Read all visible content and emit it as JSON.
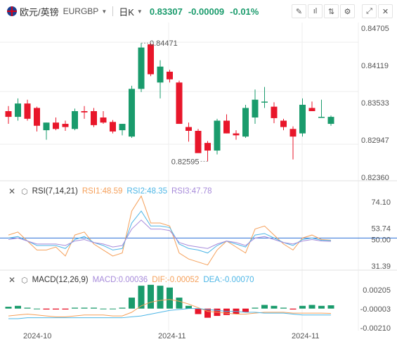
{
  "header": {
    "name": "欧元/英镑",
    "code": "EURGBP",
    "timeframe": "日K",
    "price": "0.83307",
    "change": "-0.00009",
    "change_pct": "-0.01%"
  },
  "toolbar": {
    "icons": [
      "draw-icon",
      "indicator-icon",
      "compare-icon",
      "settings-icon",
      "fullscreen-icon",
      "close-icon"
    ]
  },
  "colors": {
    "up": "#1a9b6c",
    "down": "#e8162a",
    "rsi1": "#f5a05a",
    "rsi2": "#4db6e6",
    "rsi3": "#a78bda",
    "macd": "#1a9b6c",
    "dif": "#f5a05a",
    "dea": "#4db6e6",
    "refline": "#2a6fd6"
  },
  "price_axis": [
    "0.84705",
    "0.84119",
    "0.83533",
    "0.82947",
    "0.82360"
  ],
  "high_label": "0.84471",
  "low_label": "0.82595",
  "rsi": {
    "title": "RSI(7,14,21)",
    "rsi1": "RSI1:48.59",
    "rsi2": "RSI2:48.35",
    "rsi3": "RSI3:47.78",
    "axis": [
      "74.10",
      "53.74",
      "50.00",
      "31.39"
    ]
  },
  "macd": {
    "title": "MACD(12,26,9)",
    "macd": "MACD:0.00036",
    "dif": "DIF:-0.00052",
    "dea": "DEA:-0.00070",
    "axis": [
      "0.00205",
      "-0.00003",
      "-0.00210"
    ]
  },
  "x_labels": [
    "2024-10",
    "2024-11",
    "2024-11"
  ],
  "chart_data": {
    "type": "candlestick",
    "ohlc": [
      [
        0.834,
        0.8348,
        0.832,
        0.8331
      ],
      [
        0.8331,
        0.836,
        0.8325,
        0.8352
      ],
      [
        0.8352,
        0.8358,
        0.8325,
        0.8328
      ],
      [
        0.8345,
        0.8347,
        0.8308,
        0.8317
      ],
      [
        0.831,
        0.8322,
        0.8295,
        0.8322
      ],
      [
        0.8322,
        0.833,
        0.831,
        0.8312
      ],
      [
        0.832,
        0.8325,
        0.8309,
        0.8315
      ],
      [
        0.8312,
        0.8344,
        0.831,
        0.834
      ],
      [
        0.834,
        0.8348,
        0.8328,
        0.8338
      ],
      [
        0.834,
        0.8345,
        0.8315,
        0.8318
      ],
      [
        0.833,
        0.834,
        0.832,
        0.8322
      ],
      [
        0.8323,
        0.8326,
        0.8305,
        0.8308
      ],
      [
        0.831,
        0.832,
        0.8302,
        0.832
      ],
      [
        0.83,
        0.838,
        0.8298,
        0.8375
      ],
      [
        0.8375,
        0.8447,
        0.837,
        0.844
      ],
      [
        0.8445,
        0.8447,
        0.8395,
        0.8398
      ],
      [
        0.8385,
        0.842,
        0.836,
        0.841
      ],
      [
        0.8402,
        0.8405,
        0.8385,
        0.839
      ],
      [
        0.8385,
        0.8388,
        0.834,
        0.832
      ],
      [
        0.8315,
        0.8322,
        0.8292,
        0.8309
      ],
      [
        0.8309,
        0.8312,
        0.8275,
        0.8274
      ],
      [
        0.829,
        0.8293,
        0.8261,
        0.8278
      ],
      [
        0.8278,
        0.8328,
        0.8272,
        0.8325
      ],
      [
        0.8325,
        0.8335,
        0.8305,
        0.8305
      ],
      [
        0.8305,
        0.831,
        0.8295,
        0.8302
      ],
      [
        0.83,
        0.835,
        0.8298,
        0.8345
      ],
      [
        0.833,
        0.8374,
        0.832,
        0.8358
      ],
      [
        0.8355,
        0.8378,
        0.8345,
        0.8355
      ],
      [
        0.8347,
        0.8354,
        0.8321,
        0.8329
      ],
      [
        0.8325,
        0.8328,
        0.831,
        0.8315
      ],
      [
        0.8312,
        0.8316,
        0.8264,
        0.83
      ],
      [
        0.8305,
        0.836,
        0.83,
        0.835
      ],
      [
        0.8345,
        0.8355,
        0.834,
        0.834
      ],
      [
        0.833,
        0.8358,
        0.833,
        0.8331
      ],
      [
        0.832,
        0.8333,
        0.8317,
        0.8331
      ]
    ],
    "rsi1": [
      52,
      54,
      48,
      42,
      42,
      44,
      38,
      52,
      54,
      46,
      42,
      38,
      40,
      68,
      78,
      60,
      60,
      58,
      40,
      36,
      34,
      32,
      42,
      48,
      44,
      40,
      56,
      58,
      52,
      46,
      42,
      50,
      52,
      49,
      48.6
    ],
    "rsi2": [
      50,
      51,
      48,
      45,
      45,
      45,
      43,
      49,
      51,
      47,
      45,
      42,
      43,
      60,
      68,
      58,
      58,
      57,
      46,
      43,
      42,
      40,
      45,
      48,
      46,
      44,
      52,
      53,
      50,
      47,
      45,
      49,
      50,
      48.5,
      48.35
    ],
    "rsi3": [
      49,
      50,
      48,
      46,
      46,
      46,
      45,
      48,
      49,
      47,
      46,
      44,
      45,
      56,
      62,
      56,
      56,
      55,
      47,
      45,
      44,
      43,
      46,
      48,
      47,
      45,
      50,
      51,
      49,
      47,
      46,
      48,
      49,
      48,
      47.78
    ],
    "macd_hist": [
      0.0002,
      0.0003,
      0.0001,
      0.0,
      -0.0001,
      -0.0001,
      -0.0001,
      0.0001,
      0.0001,
      0.0001,
      0.0,
      0.0,
      0.0001,
      0.0012,
      0.0025,
      0.0026,
      0.0025,
      0.0023,
      0.0012,
      0.0003,
      -0.0006,
      -0.001,
      -0.0008,
      -0.0007,
      -0.0006,
      -0.0004,
      0.0001,
      0.0004,
      0.0003,
      0.0001,
      -0.0001,
      0.0003,
      0.0004,
      0.0003,
      0.00036
    ],
    "dif": [
      -0.0008,
      -0.0007,
      -0.0006,
      -0.0007,
      -0.0008,
      -0.0009,
      -0.0009,
      -0.0008,
      -0.0007,
      -0.0007,
      -0.0007,
      -0.0008,
      -0.0008,
      -0.0004,
      0.0003,
      0.0007,
      0.0009,
      0.001,
      0.0008,
      0.0005,
      0.0001,
      -0.0003,
      -0.0004,
      -0.0005,
      -0.0006,
      -0.0006,
      -0.0005,
      -0.0004,
      -0.0004,
      -0.0004,
      -0.0005,
      -0.0005,
      -0.0005,
      -0.0005,
      -0.00052
    ],
    "dea": [
      -0.0011,
      -0.0011,
      -0.001,
      -0.001,
      -0.001,
      -0.001,
      -0.001,
      -0.001,
      -0.001,
      -0.001,
      -0.001,
      -0.001,
      -0.001,
      -0.0009,
      -0.0008,
      -0.0006,
      -0.0004,
      -0.0002,
      -0.0001,
      0.0,
      0.0,
      -0.0001,
      -0.0002,
      -0.0003,
      -0.0003,
      -0.0004,
      -0.0004,
      -0.0005,
      -0.0005,
      -0.0005,
      -0.0006,
      -0.0007,
      -0.0007,
      -0.0007,
      -0.0007
    ],
    "price_range": [
      0.8236,
      0.84705
    ],
    "rsi_range": [
      31.39,
      74.1
    ],
    "rsi_reference": 50,
    "macd_range": [
      -0.0021,
      0.00205
    ]
  }
}
